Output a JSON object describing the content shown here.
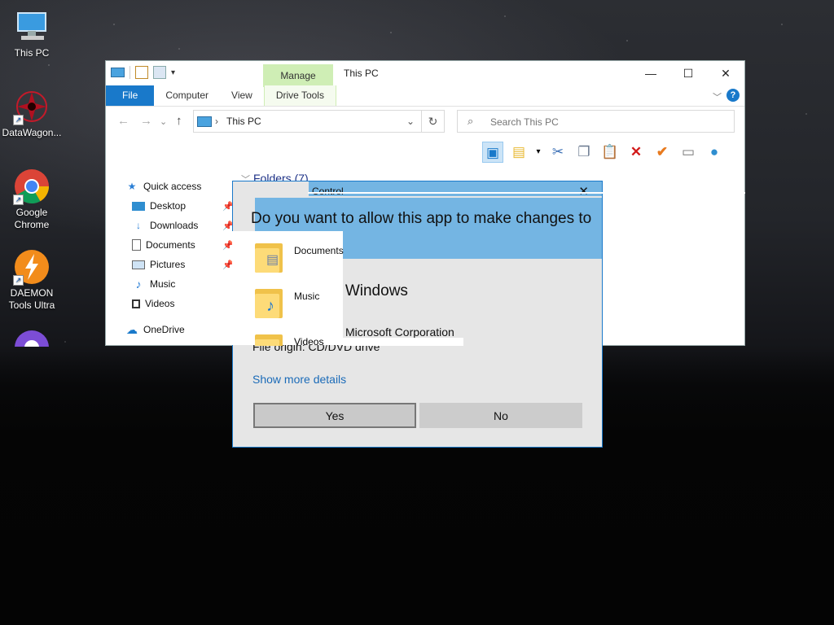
{
  "desktop": {
    "icons": [
      {
        "label": "This PC",
        "icon": "this-pc-icon"
      },
      {
        "label": "DataWagon...",
        "icon": "datawagon-icon"
      },
      {
        "label": "Google Chrome",
        "icon": "chrome-icon"
      },
      {
        "label": "DAEMON Tools Ultra",
        "icon": "daemon-tools-icon"
      }
    ]
  },
  "explorer": {
    "title": "This PC",
    "manage_tab": "Manage",
    "tabs": {
      "file": "File",
      "computer": "Computer",
      "view": "View",
      "drive_tools": "Drive Tools"
    },
    "address": "This PC",
    "search_placeholder": "Search This PC",
    "nav": {
      "quick_access": "Quick access",
      "desktop": "Desktop",
      "downloads": "Downloads",
      "documents": "Documents",
      "pictures": "Pictures",
      "music": "Music",
      "videos": "Videos",
      "onedrive": "OneDrive"
    },
    "folders_header": "Folders (7)",
    "folders": [
      {
        "label": "Documents"
      },
      {
        "label": "Music"
      },
      {
        "label": "Videos"
      }
    ]
  },
  "uac": {
    "title": "Control",
    "question": "Do you want to allow this app to make changes to your device?",
    "app_name": "ft Windows",
    "publisher": "Microsoft Corporation",
    "origin": "File origin: CD/DVD drive",
    "show_more": "Show more details",
    "yes": "Yes",
    "no": "No"
  },
  "colors": {
    "accent": "#1979ca",
    "uac_header": "#74b5e3",
    "manage_tab": "#cfeeb5"
  }
}
